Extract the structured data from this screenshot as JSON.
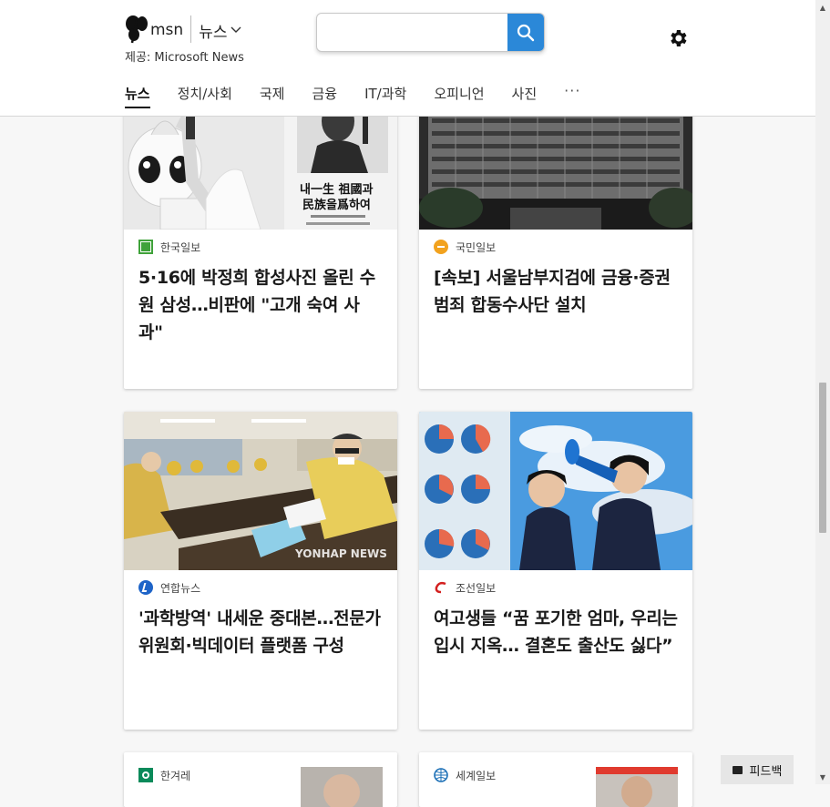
{
  "header": {
    "brand": "msn",
    "channel": "뉴스",
    "provider": "제공: Microsoft News",
    "search": {
      "value": "",
      "placeholder": ""
    }
  },
  "nav": {
    "items": [
      "뉴스",
      "정치/사회",
      "국제",
      "금융",
      "IT/과학",
      "오피니언",
      "사진"
    ],
    "more": "···"
  },
  "cards": [
    {
      "source": "한국일보",
      "headline": "5·16에 박정희 합성사진 올린 수원 삼성…비판에 \"고개 숙여 사과\"",
      "image_caption": "내一生 祖國과 民族을爲하여"
    },
    {
      "source": "국민일보",
      "headline": "[속보] 서울남부지검에 금융·증권범죄 합동수사단 설치"
    },
    {
      "source": "연합뉴스",
      "headline": "'과학방역' 내세운 중대본…전문가위원회·빅데이터 플랫폼 구성",
      "image_watermark": "YONHAP NEWS"
    },
    {
      "source": "조선일보",
      "headline": "여고생들 “꿈 포기한 엄마, 우리는 입시 지옥… 결혼도 출산도 싫다”"
    },
    {
      "source": "한겨레",
      "headline": ""
    },
    {
      "source": "세계일보",
      "headline": ""
    }
  ],
  "feedback": {
    "label": "피드백"
  },
  "colors": {
    "accent": "#2b88d8",
    "background": "#f7f7f7"
  }
}
